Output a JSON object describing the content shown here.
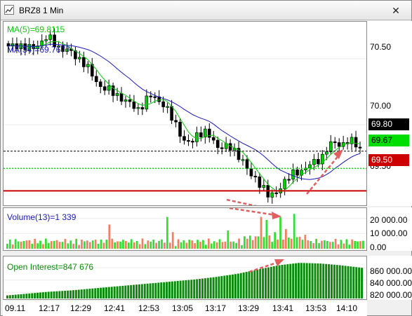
{
  "window": {
    "title": "BRZ8 1 Min",
    "close_glyph": "✕",
    "icon": "chart-icon"
  },
  "colors": {
    "bull": "#00cc00",
    "bear": "#000000",
    "ma5": "#10c810",
    "ma34": "#1a1ab8",
    "vol_up": "#33dd33",
    "vol_down": "#f08060",
    "oi": "#0a8a0a",
    "red_level": "#cc0000",
    "green_level": "#00dd00",
    "arrow": "#e06060"
  },
  "price_pane": {
    "ma5_label": "MA(5)=69.8115",
    "ma34_label": "MA(34)=69.7677",
    "ticks": [
      "70.50",
      "70.00",
      "69.50"
    ],
    "last_price_badge": "69.80",
    "green_level_badge": "69.67",
    "red_level_badge": "69.50"
  },
  "volume_pane": {
    "label": "Volume(13)=1 339",
    "ticks": [
      "20 000.00",
      "10 000.00",
      "0.00"
    ]
  },
  "oi_pane": {
    "label": "Open Interest=847 676",
    "ticks": [
      "860 000.00",
      "840 000.00",
      "820 000.00"
    ]
  },
  "time_axis": [
    "09.11",
    "12:17",
    "12:29",
    "12:41",
    "12:53",
    "13:05",
    "13:17",
    "13:29",
    "13:41",
    "13:53",
    "14:10"
  ],
  "chart_data": [
    {
      "type": "candlestick",
      "title": "BRZ8 1 Min",
      "ylim": [
        69.38,
        70.78
      ],
      "x_ticks": [
        "09.11",
        "12:17",
        "12:29",
        "12:41",
        "12:53",
        "13:05",
        "13:17",
        "13:29",
        "13:41",
        "13:53",
        "14:10"
      ],
      "series": [
        {
          "name": "MA(5)",
          "last": 69.8115
        },
        {
          "name": "MA(34)",
          "last": 69.7677
        }
      ],
      "levels": {
        "last": 69.8,
        "green_line": 69.67,
        "red_line": 69.5
      },
      "close_path": [
        70.58,
        70.61,
        70.6,
        70.57,
        70.59,
        70.63,
        70.66,
        70.62,
        70.58,
        70.56,
        70.53,
        70.5,
        70.44,
        70.36,
        70.3,
        70.27,
        70.24,
        70.22,
        70.18,
        70.14,
        70.12,
        70.18,
        70.22,
        70.19,
        70.15,
        70.05,
        69.98,
        69.88,
        69.85,
        69.93,
        69.96,
        69.9,
        69.83,
        69.85,
        69.82,
        69.78,
        69.74,
        69.62,
        69.58,
        69.55,
        69.45,
        69.47,
        69.56,
        69.6,
        69.63,
        69.66,
        69.69,
        69.71,
        69.75,
        69.83,
        69.86,
        69.85,
        69.88,
        69.86,
        69.82
      ]
    },
    {
      "type": "bar",
      "title": "Volume(13)",
      "ylim": [
        0,
        25000
      ],
      "last": 1339,
      "spikes": [
        16000,
        21000,
        11000,
        12000,
        21000,
        19000,
        11000,
        21000,
        13000,
        23000
      ]
    },
    {
      "type": "bar",
      "title": "Open Interest",
      "ylim": [
        810000,
        875000
      ],
      "last": 847676,
      "values": [
        815000,
        818000,
        821000,
        823000,
        826000,
        829000,
        832000,
        835000,
        838000,
        841000,
        845000,
        850000,
        857000,
        864000,
        868000,
        867000,
        864000,
        860000
      ]
    }
  ]
}
